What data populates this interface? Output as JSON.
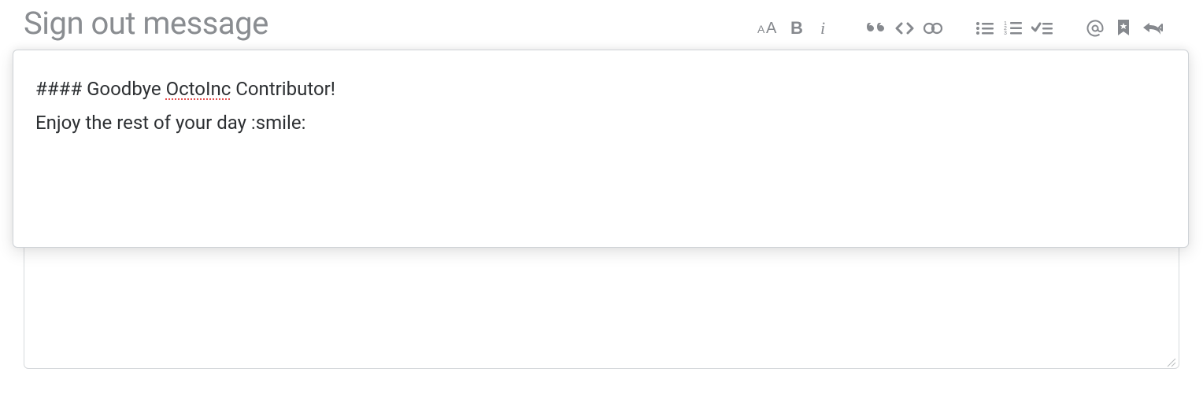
{
  "title": "Sign out message",
  "editor": {
    "line1_prefix": "#### Goodbye ",
    "line1_spellword": "OctoInc",
    "line1_suffix": " Contributor!",
    "line2": "Enjoy the rest of your day :smile:"
  },
  "toolbar": {
    "heading_label": "Heading",
    "bold_label": "Bold",
    "italic_label": "Italic",
    "quote_label": "Quote",
    "code_label": "Code",
    "link_label": "Link",
    "ul_label": "Unordered list",
    "ol_label": "Ordered list",
    "task_label": "Task list",
    "mention_label": "Mention",
    "bookmark_label": "Reference",
    "reply_label": "Reply"
  }
}
